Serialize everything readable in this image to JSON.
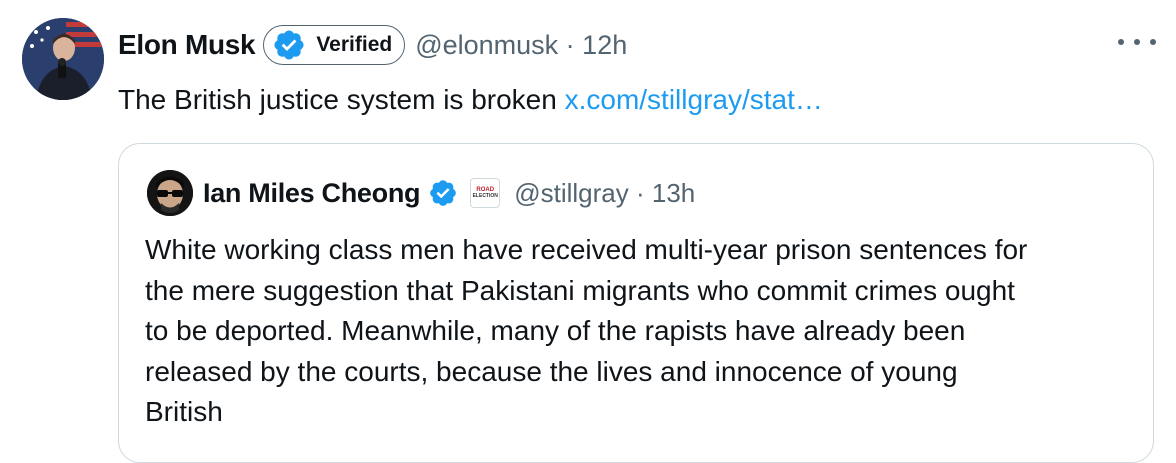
{
  "tweet": {
    "author": {
      "name": "Elon Musk",
      "badge_label": "Verified",
      "handle": "@elonmusk",
      "time": "12h"
    },
    "text": "The British justice system is broken",
    "link_text": "x.com/stillgray/stat…",
    "more_icon": "more-dots-icon"
  },
  "quote": {
    "author": {
      "name": "Ian Miles Cheong",
      "handle": "@stillgray",
      "time": "13h",
      "affiliate_badge": {
        "line1": "ROAD",
        "line2": "ELECTION"
      }
    },
    "text_lines": [
      "White working class men have received multi-year prison sentences for",
      "the mere suggestion that Pakistani migrants who commit crimes ought",
      "to be deported. Meanwhile, many of the rapists have already been",
      "released by the courts, because the lives and innocence of young",
      "British"
    ]
  },
  "colors": {
    "accent": "#1d9bf0",
    "secondary_text": "#536471",
    "border": "#cfd9de"
  }
}
